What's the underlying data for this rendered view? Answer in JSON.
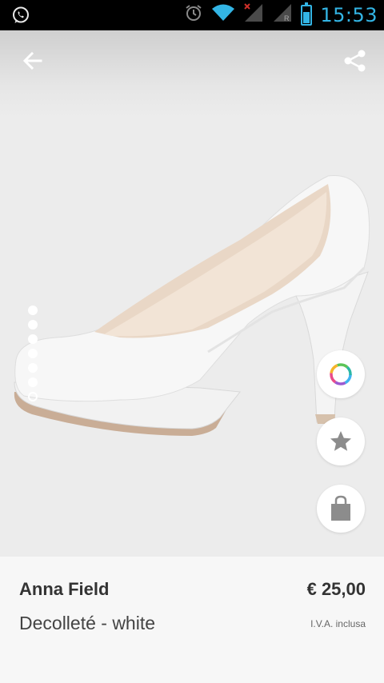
{
  "status_bar": {
    "time": "15:53",
    "icons": [
      "whatsapp-icon",
      "alarm-icon",
      "wifi-icon",
      "signal-icon",
      "signal-icon",
      "battery-icon"
    ],
    "accent_color": "#33b5e5"
  },
  "toolbar": {
    "back_icon": "arrow-left-icon",
    "share_icon": "share-icon"
  },
  "gallery": {
    "image_count": 7,
    "current_index": 6,
    "actions": [
      "color-picker-icon",
      "star-icon",
      "shopping-bag-icon"
    ]
  },
  "product": {
    "brand": "Anna Field",
    "name": "Decolleté - white",
    "price": "€ 25,00",
    "vat_note": "I.V.A. inclusa"
  }
}
